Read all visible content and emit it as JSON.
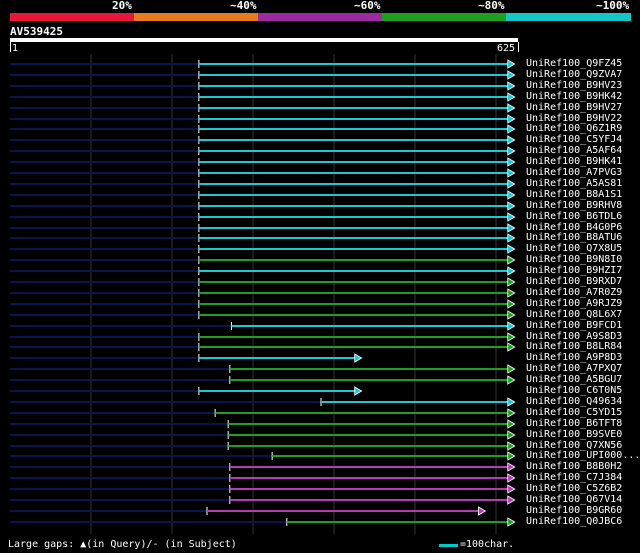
{
  "legend": {
    "labels": [
      "20%",
      "~40%",
      "~60%",
      "~80%",
      "~100%"
    ],
    "colors": [
      "#e8173a",
      "#e87c1e",
      "#9c2aa0",
      "#1ea01e",
      "#14c8c8"
    ]
  },
  "query": {
    "id": "AV539425",
    "start_label": "1",
    "end_label": "625",
    "length": 625
  },
  "colors": {
    "cyan": "#1ec8d2",
    "green": "#1ea01e",
    "magenta": "#b43cb4",
    "navy": "#0a1450",
    "grid": "#333333"
  },
  "hits": [
    {
      "name": "UniRef100_Q9FZ45",
      "start": 233,
      "end": 621,
      "color": "cyan"
    },
    {
      "name": "UniRef100_Q9ZVA7",
      "start": 233,
      "end": 621,
      "color": "cyan"
    },
    {
      "name": "UniRef100_B9HV23",
      "start": 233,
      "end": 621,
      "color": "cyan"
    },
    {
      "name": "UniRef100_B9HK42",
      "start": 233,
      "end": 621,
      "color": "cyan"
    },
    {
      "name": "UniRef100_B9HV27",
      "start": 233,
      "end": 621,
      "color": "cyan"
    },
    {
      "name": "UniRef100_B9HV22",
      "start": 233,
      "end": 621,
      "color": "cyan"
    },
    {
      "name": "UniRef100_Q6Z1R9",
      "start": 233,
      "end": 621,
      "color": "cyan"
    },
    {
      "name": "UniRef100_C5YFJ4",
      "start": 233,
      "end": 621,
      "color": "cyan"
    },
    {
      "name": "UniRef100_A5AF64",
      "start": 233,
      "end": 621,
      "color": "cyan"
    },
    {
      "name": "UniRef100_B9HK41",
      "start": 233,
      "end": 621,
      "color": "cyan"
    },
    {
      "name": "UniRef100_A7PVG3",
      "start": 233,
      "end": 621,
      "color": "cyan"
    },
    {
      "name": "UniRef100_A5AS81",
      "start": 233,
      "end": 621,
      "color": "cyan"
    },
    {
      "name": "UniRef100_B8A1S1",
      "start": 233,
      "end": 621,
      "color": "cyan"
    },
    {
      "name": "UniRef100_B9RHV8",
      "start": 233,
      "end": 621,
      "color": "cyan"
    },
    {
      "name": "UniRef100_B6TDL6",
      "start": 233,
      "end": 621,
      "color": "cyan"
    },
    {
      "name": "UniRef100_B4G0P6",
      "start": 233,
      "end": 621,
      "color": "cyan"
    },
    {
      "name": "UniRef100_B8ATU6",
      "start": 233,
      "end": 621,
      "color": "cyan"
    },
    {
      "name": "UniRef100_Q7X8U5",
      "start": 233,
      "end": 621,
      "color": "cyan"
    },
    {
      "name": "UniRef100_B9N8I0",
      "start": 233,
      "end": 621,
      "color": "green"
    },
    {
      "name": "UniRef100_B9HZI7",
      "start": 233,
      "end": 621,
      "color": "cyan"
    },
    {
      "name": "UniRef100_B9RXD7",
      "start": 233,
      "end": 621,
      "color": "green"
    },
    {
      "name": "UniRef100_A7R0Z9",
      "start": 233,
      "end": 621,
      "color": "green"
    },
    {
      "name": "UniRef100_A9RJZ9",
      "start": 233,
      "end": 621,
      "color": "green"
    },
    {
      "name": "UniRef100_Q8L6X7",
      "start": 233,
      "end": 621,
      "color": "green"
    },
    {
      "name": "UniRef100_B9FCD1",
      "start": 273,
      "end": 621,
      "color": "cyan"
    },
    {
      "name": "UniRef100_A9S8D3",
      "start": 233,
      "end": 621,
      "color": "green"
    },
    {
      "name": "UniRef100_B8LR84",
      "start": 233,
      "end": 621,
      "color": "green"
    },
    {
      "name": "UniRef100_A9P8D3",
      "start": 233,
      "end": 433,
      "color": "cyan"
    },
    {
      "name": "UniRef100_A7PXQ7",
      "start": 271,
      "end": 621,
      "color": "green"
    },
    {
      "name": "UniRef100_A5BGU7",
      "start": 271,
      "end": 621,
      "color": "green"
    },
    {
      "name": "UniRef100_C6T0N5",
      "start": 233,
      "end": 433,
      "color": "cyan"
    },
    {
      "name": "UniRef100_Q49634",
      "start": 383,
      "end": 621,
      "color": "cyan"
    },
    {
      "name": "UniRef100_C5YD15",
      "start": 253,
      "end": 621,
      "color": "green"
    },
    {
      "name": "UniRef100_B6TFT8",
      "start": 269,
      "end": 621,
      "color": "green"
    },
    {
      "name": "UniRef100_B9SVE0",
      "start": 269,
      "end": 621,
      "color": "green"
    },
    {
      "name": "UniRef100_Q7XN56",
      "start": 269,
      "end": 621,
      "color": "green"
    },
    {
      "name": "UniRef100_UPI000...",
      "start": 323,
      "end": 621,
      "color": "green"
    },
    {
      "name": "UniRef100_B8B0H2",
      "start": 271,
      "end": 621,
      "color": "magenta"
    },
    {
      "name": "UniRef100_C7J384",
      "start": 271,
      "end": 621,
      "color": "magenta"
    },
    {
      "name": "UniRef100_C5Z6B2",
      "start": 271,
      "end": 621,
      "color": "magenta"
    },
    {
      "name": "UniRef100_Q67V14",
      "start": 271,
      "end": 621,
      "color": "magenta"
    },
    {
      "name": "UniRef100_B9GR60",
      "start": 243,
      "end": 585,
      "color": "magenta"
    },
    {
      "name": "UniRef100_Q0JBC6",
      "start": 341,
      "end": 621,
      "color": "green"
    }
  ],
  "footer": {
    "gap_text": "Large gaps: ▲(in Query)/- (in Subject)",
    "scale_text": "=100char."
  }
}
